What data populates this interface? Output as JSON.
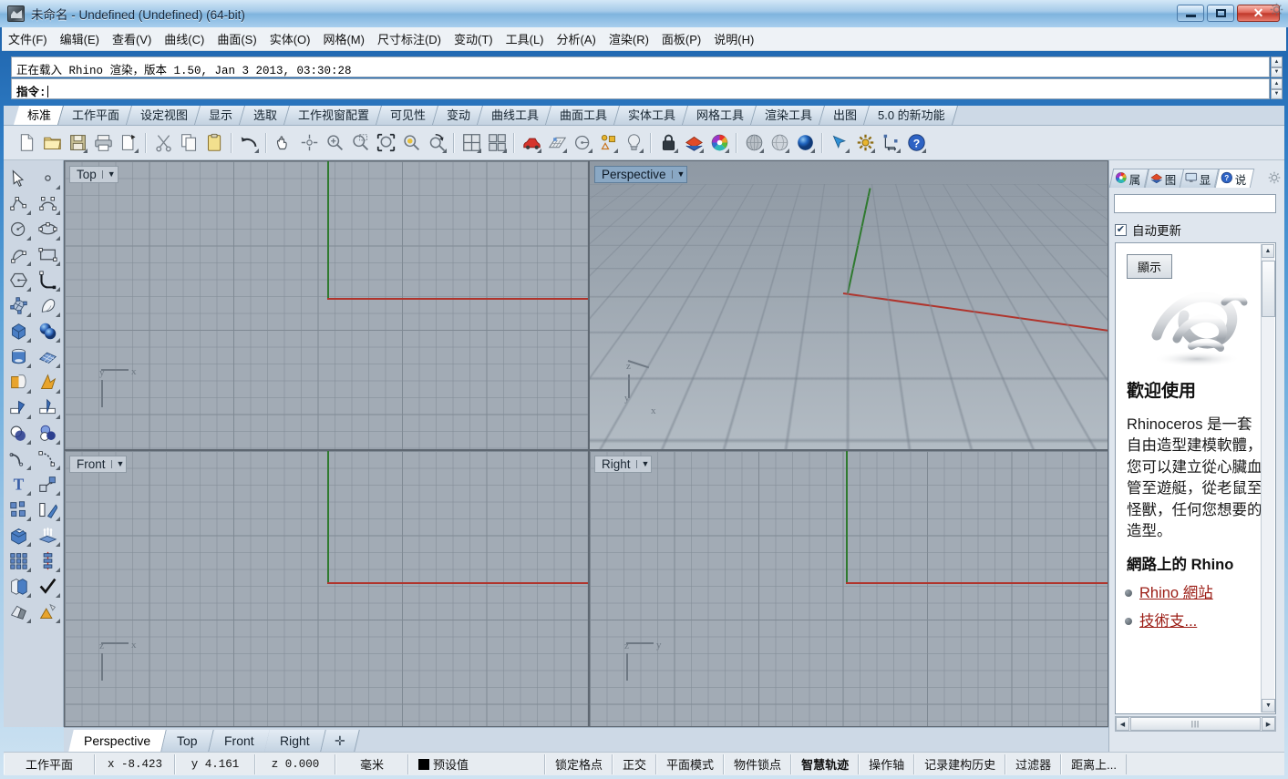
{
  "window": {
    "title": "未命名 - Undefined (Undefined) (64-bit)",
    "icon": "rhino-app-icon",
    "minimize_label": "–",
    "maximize_label": "□",
    "close_label": "✕"
  },
  "menubar": {
    "items": [
      {
        "label": "文件(F)",
        "name": "menu-file"
      },
      {
        "label": "编辑(E)",
        "name": "menu-edit"
      },
      {
        "label": "查看(V)",
        "name": "menu-view"
      },
      {
        "label": "曲线(C)",
        "name": "menu-curve"
      },
      {
        "label": "曲面(S)",
        "name": "menu-surface"
      },
      {
        "label": "实体(O)",
        "name": "menu-solid"
      },
      {
        "label": "网格(M)",
        "name": "menu-mesh"
      },
      {
        "label": "尺寸标注(D)",
        "name": "menu-dimension"
      },
      {
        "label": "变动(T)",
        "name": "menu-transform"
      },
      {
        "label": "工具(L)",
        "name": "menu-tools"
      },
      {
        "label": "分析(A)",
        "name": "menu-analyze"
      },
      {
        "label": "渲染(R)",
        "name": "menu-render"
      },
      {
        "label": "面板(P)",
        "name": "menu-panels"
      },
      {
        "label": "说明(H)",
        "name": "menu-help"
      }
    ]
  },
  "command": {
    "history": "正在载入 Rhino 渲染，版本 1.50, Jan  3 2013, 03:30:28",
    "prompt_label": "指令:",
    "prompt_value": ""
  },
  "toolbar_tabs": {
    "items": [
      {
        "label": "标准",
        "active": true
      },
      {
        "label": "工作平面",
        "active": false
      },
      {
        "label": "设定视图",
        "active": false
      },
      {
        "label": "显示",
        "active": false
      },
      {
        "label": "选取",
        "active": false
      },
      {
        "label": "工作视窗配置",
        "active": false
      },
      {
        "label": "可见性",
        "active": false
      },
      {
        "label": "变动",
        "active": false
      },
      {
        "label": "曲线工具",
        "active": false
      },
      {
        "label": "曲面工具",
        "active": false
      },
      {
        "label": "实体工具",
        "active": false
      },
      {
        "label": "网格工具",
        "active": false
      },
      {
        "label": "渲染工具",
        "active": false
      },
      {
        "label": "出图",
        "active": false
      },
      {
        "label": "5.0 的新功能",
        "active": false
      }
    ]
  },
  "main_toolbar": {
    "buttons": [
      {
        "name": "new-file-icon",
        "glyph": "page"
      },
      {
        "name": "open-file-icon",
        "glyph": "folder"
      },
      {
        "name": "save-file-icon",
        "glyph": "floppy",
        "flyout": true
      },
      {
        "name": "print-icon",
        "glyph": "printer"
      },
      {
        "name": "copy-format-icon",
        "glyph": "pagecopy",
        "flyout": true
      },
      {
        "name": "cut-icon",
        "glyph": "scissors"
      },
      {
        "name": "copy-icon",
        "glyph": "copy"
      },
      {
        "name": "paste-icon",
        "glyph": "clipboard"
      },
      {
        "name": "undo-icon",
        "glyph": "undo",
        "flyout": true
      },
      {
        "name": "pan-icon",
        "glyph": "hand"
      },
      {
        "name": "rotate-view-icon",
        "glyph": "rotate"
      },
      {
        "name": "zoom-in-icon",
        "glyph": "zoomin"
      },
      {
        "name": "zoom-window-icon",
        "glyph": "zoomwin"
      },
      {
        "name": "zoom-extents-icon",
        "glyph": "zoomext"
      },
      {
        "name": "zoom-selected-icon",
        "glyph": "zoomsel"
      },
      {
        "name": "zoom-previous-icon",
        "glyph": "zoomprev",
        "flyout": true
      },
      {
        "name": "viewport-split-icon",
        "glyph": "vsplit",
        "flyout": true
      },
      {
        "name": "viewport-layout-icon",
        "glyph": "vlayout",
        "flyout": true
      },
      {
        "name": "render-car-icon",
        "glyph": "car",
        "flyout": true
      },
      {
        "name": "grid-plane-icon",
        "glyph": "gridplane",
        "flyout": true
      },
      {
        "name": "circle-tool-icon",
        "glyph": "circletool",
        "flyout": true
      },
      {
        "name": "object-props-icon",
        "glyph": "objprops",
        "flyout": true
      },
      {
        "name": "light-icon",
        "glyph": "bulb",
        "flyout": true
      },
      {
        "name": "lock-icon",
        "glyph": "lock",
        "flyout": true
      },
      {
        "name": "layers-icon",
        "glyph": "layers",
        "flyout": true
      },
      {
        "name": "color-wheel-icon",
        "glyph": "colorwheel",
        "flyout": true
      },
      {
        "name": "shaded-view-icon",
        "glyph": "sphere-shaded",
        "flyout": true
      },
      {
        "name": "ghosted-view-icon",
        "glyph": "sphere-ghost",
        "flyout": true
      },
      {
        "name": "rendered-view-icon",
        "glyph": "sphere-blue",
        "flyout": true
      },
      {
        "name": "select-arrow-icon",
        "glyph": "arrowsel",
        "flyout": true
      },
      {
        "name": "options-gear-icon",
        "glyph": "gear",
        "flyout": true
      },
      {
        "name": "dimension-icon",
        "glyph": "dimension",
        "flyout": true
      },
      {
        "name": "help-icon",
        "glyph": "help",
        "flyout": true
      }
    ]
  },
  "left_toolbar": {
    "buttons": [
      {
        "name": "select-object-icon",
        "glyph": "cursor"
      },
      {
        "name": "point-icon",
        "glyph": "point",
        "flyout": true
      },
      {
        "name": "polyline-icon",
        "glyph": "polyline",
        "flyout": true
      },
      {
        "name": "control-curve-icon",
        "glyph": "ctrlcurve",
        "flyout": true
      },
      {
        "name": "circle-icon",
        "glyph": "circle",
        "flyout": true
      },
      {
        "name": "ellipse-icon",
        "glyph": "ellipse",
        "flyout": true
      },
      {
        "name": "arc-icon",
        "glyph": "arc",
        "flyout": true
      },
      {
        "name": "rectangle-icon",
        "glyph": "rect",
        "flyout": true
      },
      {
        "name": "polygon-icon",
        "glyph": "polygon",
        "flyout": true
      },
      {
        "name": "fillet-curve-icon",
        "glyph": "fillet",
        "flyout": true
      },
      {
        "name": "surface-patch-icon",
        "glyph": "srfpatch",
        "flyout": true
      },
      {
        "name": "extrude-surface-icon",
        "glyph": "srfextrude",
        "flyout": true
      },
      {
        "name": "box-icon",
        "glyph": "box",
        "flyout": true
      },
      {
        "name": "sphere-icon",
        "glyph": "spheres",
        "flyout": true
      },
      {
        "name": "cylinder-icon",
        "glyph": "cylinder",
        "flyout": true
      },
      {
        "name": "mesh-plane-icon",
        "glyph": "meshplane",
        "flyout": true
      },
      {
        "name": "boolean-union-icon",
        "glyph": "boolunion",
        "flyout": true
      },
      {
        "name": "explode-icon",
        "glyph": "explode",
        "flyout": true
      },
      {
        "name": "trim-icon",
        "glyph": "trim",
        "flyout": true
      },
      {
        "name": "split-icon",
        "glyph": "split",
        "flyout": true
      },
      {
        "name": "boolean-diff-icon",
        "glyph": "booldiff",
        "flyout": true
      },
      {
        "name": "boolean-sphere-icon",
        "glyph": "boolsphere",
        "flyout": true
      },
      {
        "name": "offset-curve-icon",
        "glyph": "offsetcurve",
        "flyout": true
      },
      {
        "name": "rebuild-curve-icon",
        "glyph": "rebuild",
        "flyout": true
      },
      {
        "name": "text-icon",
        "glyph": "text",
        "flyout": true
      },
      {
        "name": "transform-icon",
        "glyph": "transform",
        "flyout": true
      },
      {
        "name": "group-icon",
        "glyph": "group",
        "flyout": true
      },
      {
        "name": "mirror-icon",
        "glyph": "mirror",
        "flyout": true
      },
      {
        "name": "cap-solid-icon",
        "glyph": "cap",
        "flyout": true
      },
      {
        "name": "extrude-up-icon",
        "glyph": "extrudeup",
        "flyout": true
      },
      {
        "name": "array-grid-icon",
        "glyph": "arraygrid",
        "flyout": true
      },
      {
        "name": "array-linear-icon",
        "glyph": "arraylin",
        "flyout": true
      },
      {
        "name": "copy-object-icon",
        "glyph": "copyobj",
        "flyout": true
      },
      {
        "name": "check-object-icon",
        "glyph": "check",
        "flyout": true
      },
      {
        "name": "shade-icon",
        "glyph": "shade",
        "flyout": true
      },
      {
        "name": "render-cone-icon",
        "glyph": "rendercone",
        "flyout": true
      }
    ]
  },
  "viewports": {
    "top": {
      "label": "Top",
      "active": false,
      "axis": {
        "h": "x",
        "v": "y"
      }
    },
    "persp": {
      "label": "Perspective",
      "active": true,
      "axis": {
        "h": "x",
        "v": "y",
        "up": "z"
      }
    },
    "front": {
      "label": "Front",
      "active": false,
      "axis": {
        "h": "x",
        "v": "z"
      }
    },
    "right": {
      "label": "Right",
      "active": false,
      "axis": {
        "h": "y",
        "v": "z"
      }
    },
    "axis_x_color": "#b0342c",
    "axis_y_color": "#2f7a2f"
  },
  "viewport_tabs": {
    "items": [
      {
        "label": "Perspective",
        "active": true
      },
      {
        "label": "Top",
        "active": false
      },
      {
        "label": "Front",
        "active": false
      },
      {
        "label": "Right",
        "active": false
      }
    ],
    "add_label": "✛"
  },
  "right_panel": {
    "tabs": [
      {
        "label": "属",
        "icon": "color-wheel-icon",
        "active": false
      },
      {
        "label": "图",
        "icon": "layers-icon",
        "active": false
      },
      {
        "label": "显",
        "icon": "display-icon",
        "active": false
      },
      {
        "label": "说",
        "icon": "help-icon",
        "active": true
      }
    ],
    "search_value": "",
    "autoupdate_label": "自动更新",
    "autoupdate_checked": "✔",
    "show_button_label": "顯示",
    "help": {
      "heading": "歡迎使用",
      "paragraph": "Rhinoceros 是一套自由造型建模軟體，您可以建立從心臟血管至遊艇，從老鼠至怪獸，任何您想要的造型。",
      "subheading": "網路上的 Rhino",
      "links": [
        "Rhino 網站",
        "技術支..."
      ]
    },
    "scroll_glyph_up": "▲",
    "scroll_glyph_down": "▼",
    "hscroll_left": "◀",
    "hscroll_right": "▶",
    "hscroll_grip": "|||"
  },
  "statusbar": {
    "cplane_label": "工作平面",
    "coord_x": "x -8.423",
    "coord_y": "y 4.161",
    "coord_z": "z 0.000",
    "units": "毫米",
    "layer": "预设值",
    "layer_color": "#000000",
    "toggles": [
      {
        "label": "锁定格点",
        "active": false
      },
      {
        "label": "正交",
        "active": false
      },
      {
        "label": "平面模式",
        "active": false
      },
      {
        "label": "物件锁点",
        "active": false
      },
      {
        "label": "智慧轨迹",
        "active": true
      },
      {
        "label": "操作轴",
        "active": false
      },
      {
        "label": "记录建构历史",
        "active": false
      },
      {
        "label": "过滤器",
        "active": false
      },
      {
        "label": "距离上...",
        "active": false
      }
    ]
  }
}
